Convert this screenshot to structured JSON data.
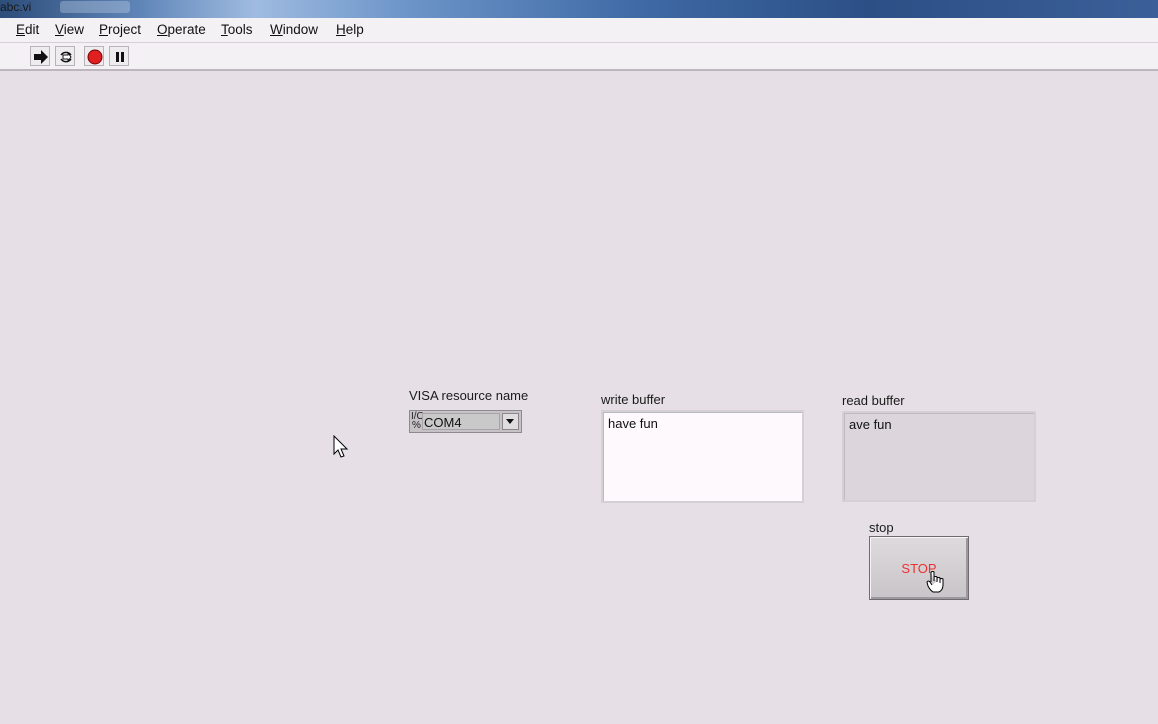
{
  "window": {
    "title": "abc.vi"
  },
  "menu": [
    "Edit",
    "View",
    "Project",
    "Operate",
    "Tools",
    "Window",
    "Help"
  ],
  "menu_mnemonics": [
    "E",
    "V",
    "P",
    "O",
    "T",
    "W",
    "H"
  ],
  "toolbar": {
    "buttons": [
      "run-arrow-icon",
      "run-continuously-icon",
      "abort-execution-icon",
      "pause-icon"
    ]
  },
  "controls": {
    "visa": {
      "label": "VISA resource name",
      "prefix": "I/O %",
      "value": "COM4"
    },
    "write": {
      "label": "write buffer",
      "value": "have fun"
    },
    "read": {
      "label": "read buffer",
      "value": "ave fun"
    },
    "stop": {
      "label": "stop",
      "button_text": "STOP"
    }
  },
  "colors": {
    "panel_bg": "#e6e0e6",
    "stop_text": "#ee3030",
    "abort_red": "#e02020"
  }
}
